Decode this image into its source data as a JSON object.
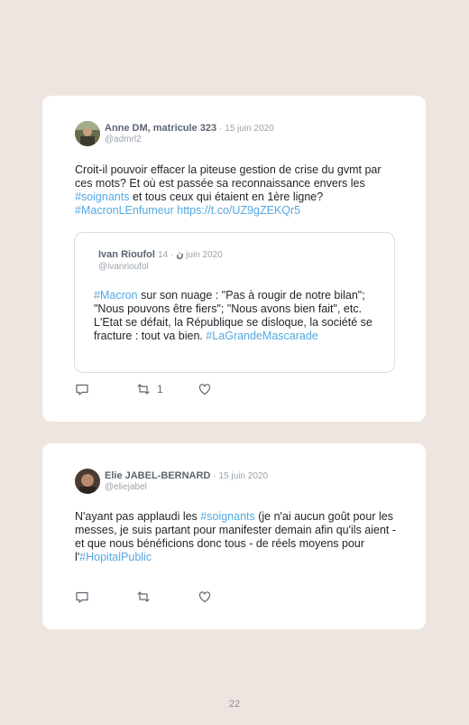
{
  "tweets": [
    {
      "name": "Anne DM, matricule 323",
      "date": "· 15 juin 2020",
      "handle": "@admrl2",
      "text_parts": {
        "p1": "Croit-il pouvoir effacer la piteuse gestion de crise du gvmt par ces mots? Et où est passée sa reconnaissance envers les ",
        "t1": "#soignants",
        "p2": " et tous ceux qui étaient en 1ère ligne? ",
        "t2": "#MacronLEnfumeur https://t.co/UZ9gZEKQr5"
      },
      "retweet_count": "1",
      "quote": {
        "name": "Ivan Rioufol",
        "verified_glyph": "ن",
        "date": "· 14 juin 2020",
        "handle": "@ivanrioufol",
        "text_parts": {
          "t1": "#Macron",
          "p1": " sur son nuage : \"Pas à rougir de notre bilan\"; \"Nous pouvons être fiers\"; \"Nous avons bien fait\", etc. L'Etat se défait, la République se disloque, la société se fracture : tout va bien. ",
          "t2": "#LaGrandeMascarade"
        }
      }
    },
    {
      "name": "Elie JABEL-BERNARD",
      "date": "· 15 juin 2020",
      "handle": "@eliejabel",
      "text_parts": {
        "p1": "N'ayant pas applaudi les ",
        "t1": "#soignants",
        "p2": " (je n'ai aucun goût pour les messes, je suis partant pour manifester demain afin qu'ils aient - et que nous bénéficions donc tous - de réels moyens pour l'",
        "t2": "#HopitalPublic"
      },
      "retweet_count": ""
    }
  ],
  "page_number": "22",
  "colors": {
    "background": "#efe5e0",
    "card": "#ffffff",
    "hashtag": "#55a8e0",
    "meta": "#9aa3ab"
  },
  "icons": [
    "reply-icon",
    "retweet-icon",
    "like-icon"
  ]
}
